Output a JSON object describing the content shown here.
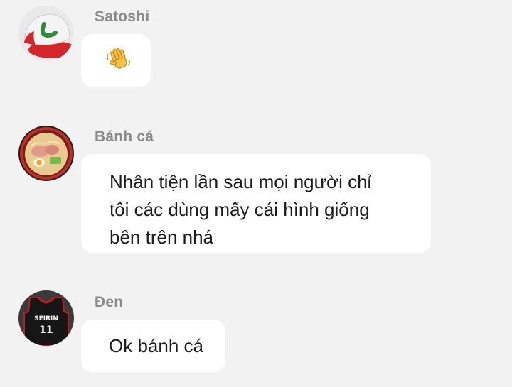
{
  "messages": [
    {
      "sender": "Satoshi",
      "avatar_icon": "red-cap-avatar-icon",
      "content_icon": "waving-hand-emoji-icon",
      "text": ""
    },
    {
      "sender": "Bánh cá",
      "avatar_icon": "ramen-bowl-avatar-icon",
      "text": "Nhân tiện lần sau mọi người chỉ\ntôi các dùng mấy cái hình giống\nbên trên nhá"
    },
    {
      "sender": "Đen",
      "avatar_icon": "basketball-jersey-avatar-icon",
      "jersey_text": "SEIRIN",
      "jersey_number": "11",
      "text": "Ok bánh cá"
    }
  ],
  "colors": {
    "background": "#f2f2f2",
    "bubble": "#ffffff",
    "sender_name": "#8a8a8a",
    "message_text": "#1c1c1c"
  }
}
